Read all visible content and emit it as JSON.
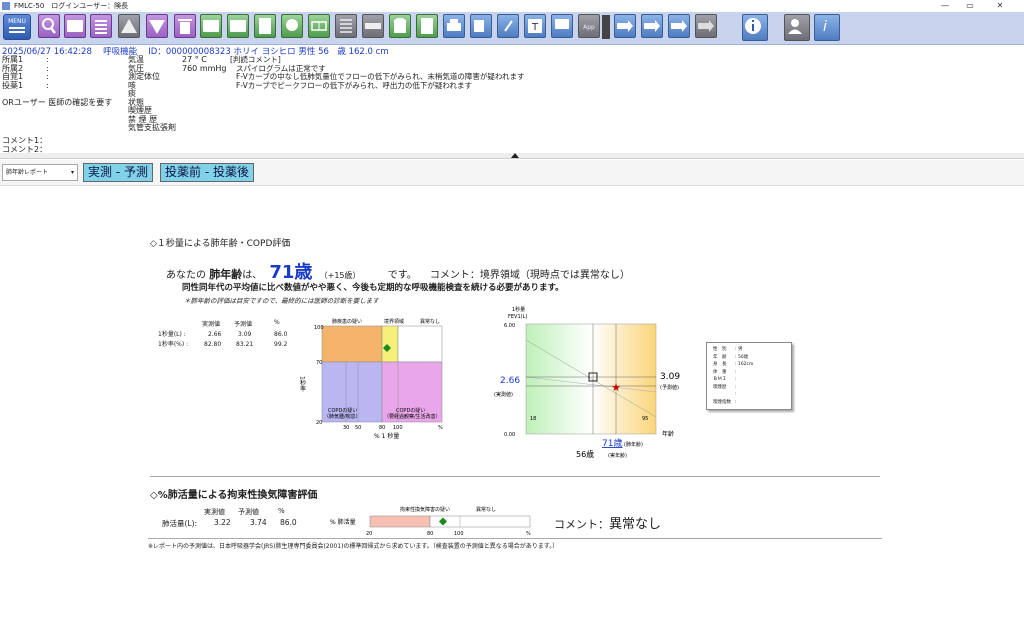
{
  "titlebar": {
    "title": "FMLC-50　ログインユーザー：険長",
    "min": "—",
    "max": "▭",
    "close": "✕"
  },
  "toolbar": {
    "menu_label": "MENU",
    "icon_names": [
      "magnifier-icon",
      "fno-report-icon",
      "list-icon",
      "up-triangle-icon",
      "down-triangle-icon",
      "trash-icon",
      "edit-or-icon",
      "check-or-icon",
      "doc-check-icon",
      "clock-check-icon",
      "grid-icon",
      "list2-icon",
      "ruler-icon",
      "shirt-icon",
      "add-doc-icon",
      "printer-icon",
      "print-preview-icon",
      "attach-icon",
      "text-icon",
      "monitor-icon",
      "app-icon",
      "dropdown-icon",
      "arrow1-icon",
      "arrow2-icon",
      "arrow3-icon",
      "arrow4-icon",
      "info-icon",
      "user-icon",
      "ifno-icon"
    ],
    "text_label": "T",
    "app_label": "App"
  },
  "patient": {
    "datetime": "2025/06/27 16:42:28",
    "exam": "呼吸機能",
    "id_label": "ID：000000008323",
    "name": "ホリイ ヨシヒロ",
    "sex": "男性",
    "age": "56　歳",
    "height": "162.0 cm"
  },
  "info_left": [
    "所属1",
    "所属2",
    "自覚1",
    "投薬1",
    "",
    "ORユーザー 医師の確認を要す"
  ],
  "info_mid_labels": [
    "気温",
    "気圧",
    "測定体位",
    "咳",
    "痰",
    "状態",
    "喫煙歴",
    "禁 煙 歴",
    "気管支拡張剤"
  ],
  "info_mid_values": [
    "27 ° C",
    "760 mmHg",
    "",
    "",
    "",
    "",
    "",
    "",
    ""
  ],
  "judge": {
    "title": "[判読コメント]",
    "lines": [
      "スパイログラムは正常です",
      "F-Vカーブの中なし低肺気量位でフローの低下がみられ、末梢気道の障害が疑われます",
      "F-Vカーブでピークフローの低下がみられ、呼出力の低下が疑われます"
    ]
  },
  "comments": [
    "コメント1：",
    "コメント2："
  ],
  "controls": {
    "report_select": "肺年齢レポート",
    "btn1": "実測 - 予測",
    "btn2": "投薬前 - 投薬後"
  },
  "report": {
    "sec1_title": "◇１秒量による肺年齢・COPD評価",
    "age_prefix": "あなたの",
    "age_word": "肺年齢",
    "age_ha": "は、",
    "age_value": "71歳",
    "age_diff": "（+15歳）",
    "age_desu": "です。",
    "comment": "コメント：境界領域（現時点では異常なし）",
    "advice": "同性同年代の平均値に比べ数値がやや悪く、今後も定期的な呼吸機能検査を続ける必要があります。",
    "note": "＊肺年齢の評価は目安ですので、最終的には医師の診断を要します",
    "tbl_head": [
      "実測値",
      "予測値",
      "%"
    ],
    "tbl_rows": [
      {
        "label": "1秒量(L) :",
        "a": "2.66",
        "b": "3.09",
        "c": "86.0"
      },
      {
        "label": "1秒率(%) :",
        "a": "82.80",
        "b": "83.21",
        "c": "99.2"
      }
    ],
    "copd": {
      "top_labels": [
        "肺疾患の疑い",
        "境界領域",
        "異常なし"
      ],
      "y_labels": [
        "100",
        "70",
        "20"
      ],
      "y_axis": "1秒率",
      "x_labels": [
        "30",
        "50",
        "80",
        "100",
        "%"
      ],
      "x_axis": "% 1 秒量",
      "box1": "COPDの疑い",
      "box1b": "（肺気腫/喘息）",
      "box2": "COPDの疑い",
      "box2b": "（要経過観察/生活改善）"
    },
    "age_chart": {
      "y_title": "1秒量",
      "y_title2": "FEV1(L)",
      "y_max": "6.00",
      "y_min": "0.00",
      "measured": "2.66",
      "measured_label": "(実測値)",
      "predicted": "3.09",
      "predicted_label": "(予測値)",
      "x_left": "18",
      "x_right": "95",
      "x_axis": "年齢",
      "lung_age": "71歳",
      "lung_age_label": "(肺年齢)",
      "real_age": "56歳",
      "real_age_label": "(実年齢)"
    },
    "profile": [
      [
        "性　別",
        "男"
      ],
      [
        "年　齢",
        "56歳"
      ],
      [
        "身　長",
        "162cm"
      ],
      [
        "体　重",
        ""
      ],
      [
        "ＢＭＩ",
        ""
      ],
      [
        "喫煙歴",
        ""
      ],
      [
        "",
        ""
      ],
      [
        "喫煙指数",
        ""
      ]
    ],
    "sec2_title": "◇%肺活量による拘束性換気障害評価",
    "vc_head": [
      "実測値",
      "予測値",
      "%"
    ],
    "vc_row": {
      "label": "肺活量(L):",
      "a": "3.22",
      "b": "3.74",
      "c": "86.0"
    },
    "vc_bar_label": "% 肺活量",
    "vc_zones": [
      "拘束性換気障害の疑い",
      "異常なし"
    ],
    "vc_ticks": [
      "20",
      "80",
      "100",
      "%"
    ],
    "vc_comment_label": "コメント：",
    "vc_comment": "異常なし",
    "footnote": "※レポート内の予測値は、日本呼吸器学会(JRS)肺生理専門委員会(2001)の標準回帰式から求めています。（検査装置の予測値と異なる場合があります。）"
  }
}
